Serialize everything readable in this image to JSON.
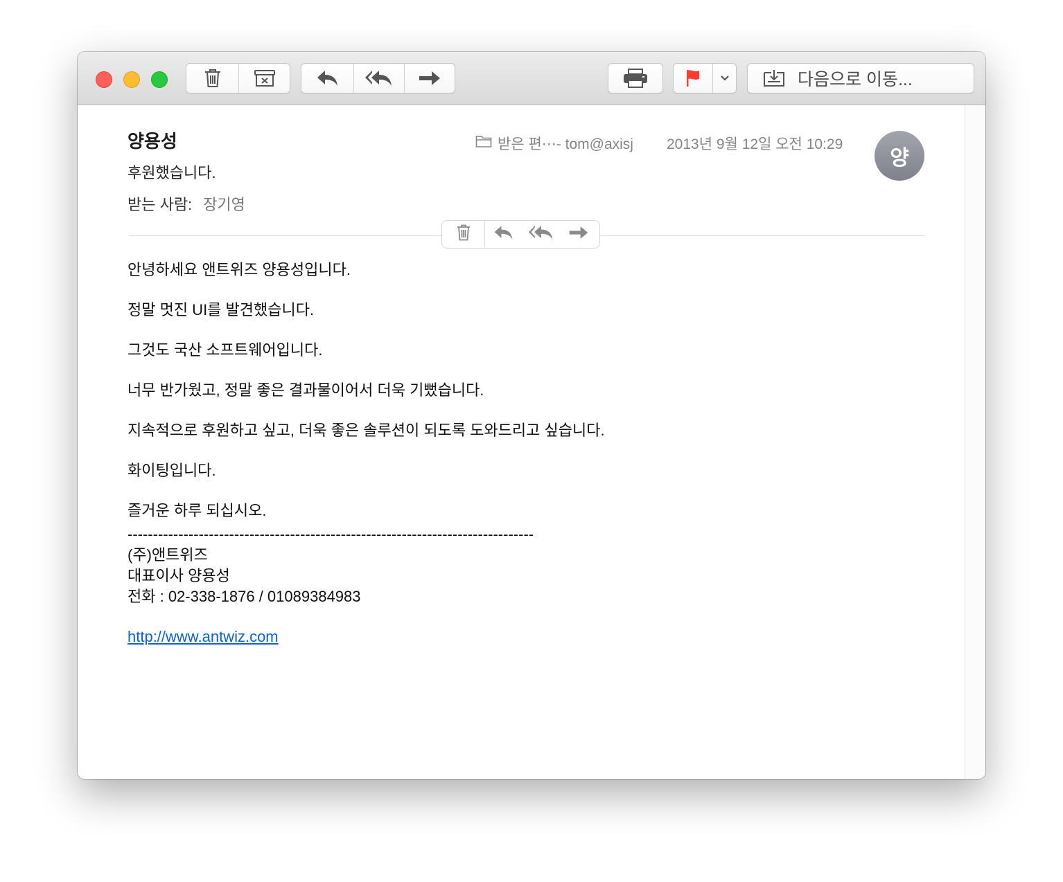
{
  "window": {
    "traffic_lights": [
      "close",
      "minimize",
      "zoom"
    ]
  },
  "toolbar": {
    "groups": {
      "trash_archive": [
        "trash-icon",
        "archive-icon"
      ],
      "reply_group": [
        "reply-icon",
        "reply-all-icon",
        "forward-icon"
      ],
      "print": [
        "printer-icon"
      ],
      "flag": [
        "flag-icon",
        "chevron-down-icon"
      ]
    },
    "move_label": "다음으로 이동..."
  },
  "colors": {
    "flag": "#ff3b30",
    "link": "#0a62d6",
    "avatar": "#8e9099"
  },
  "message": {
    "sender": "양용성",
    "subject": "후원했습니다.",
    "to_label": "받는 사람:",
    "to_value": "장기영",
    "mailbox": "받은 편⋯- tom@axisj",
    "date": "2013년 9월 12일 오전 10:29",
    "avatar_initial": "양"
  },
  "body": {
    "paragraphs": [
      "안녕하세요 앤트위즈 양용성입니다.",
      "정말 멋진 UI를 발견했습니다.",
      "그것도 국산 소프트웨어입니다.",
      "너무 반가웠고, 정말 좋은 결과물이어서 더욱 기뻤습니다.",
      "지속적으로 후원하고 싶고, 더욱 좋은 솔루션이 되도록 도와드리고 싶습니다.",
      "화이팅입니다.",
      "즐거운 하루 되십시오."
    ],
    "signature": {
      "separator": "--------------------------------------------------------------------------------",
      "company": "(주)앤트위즈",
      "title": "대표이사 양용성",
      "phone": "전화 : 02-338-1876  / 01089384983"
    },
    "link": "http://www.antwiz.com"
  }
}
